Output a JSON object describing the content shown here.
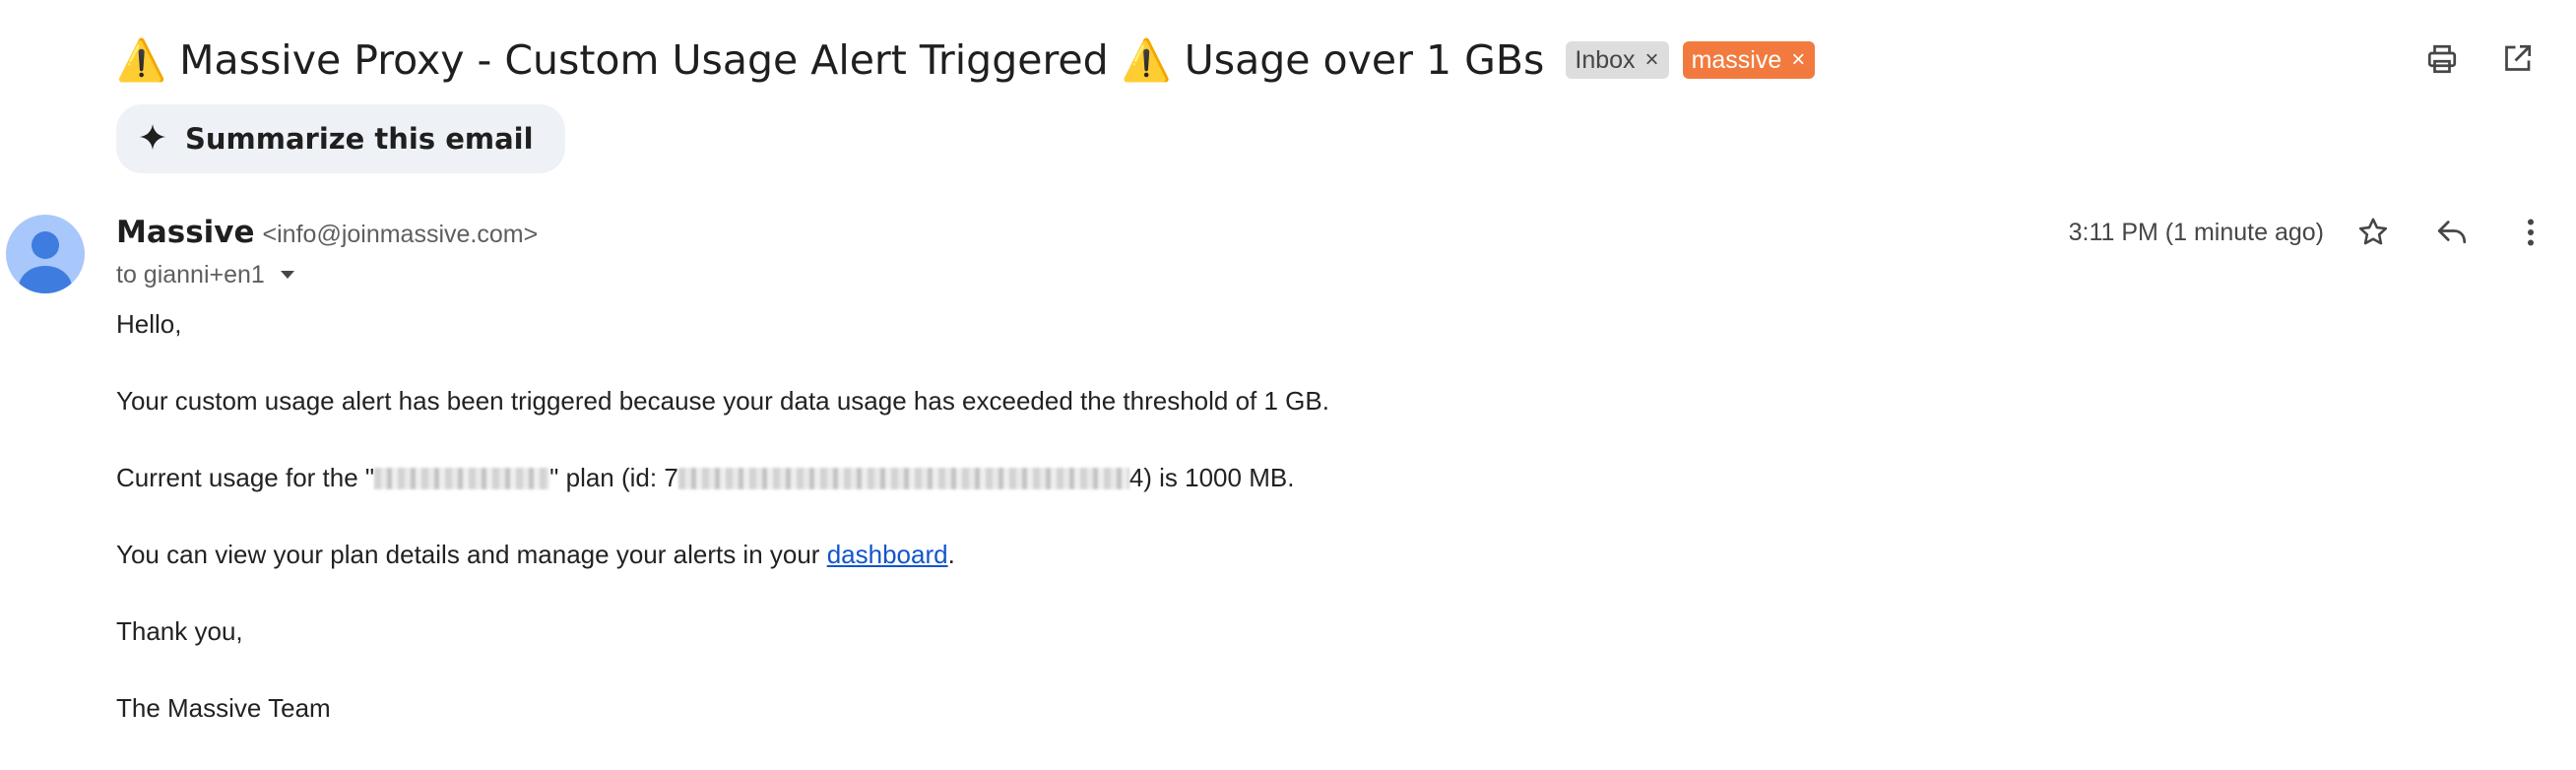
{
  "subject": {
    "text": "⚠️ Massive Proxy - Custom Usage Alert Triggered ⚠️ Usage over 1 GBs",
    "labels": [
      {
        "name": "Inbox",
        "color": "#dddddd",
        "text_color": "#444746"
      },
      {
        "name": "massive",
        "color": "#f27a3e",
        "text_color": "#ffffff"
      }
    ],
    "label_close_glyph": "×"
  },
  "top_actions": {
    "icons": [
      "print-icon",
      "open-in-new-window-icon"
    ]
  },
  "summarize": {
    "label": "Summarize this email",
    "icon": "sparkle-icon"
  },
  "sender": {
    "name": "Massive",
    "email": "<info@joinmassive.com>",
    "recipient": "to gianni+en1",
    "avatar_icon": "person-icon",
    "avatar_color": "#a8c7fa"
  },
  "meta": {
    "timestamp": "3:11 PM (1 minute ago)",
    "icons": [
      "star-icon",
      "reply-icon",
      "more-vert-icon"
    ]
  },
  "body": {
    "greeting": "Hello,",
    "line1": "Your custom usage alert has been triggered because your data usage has exceeded the threshold of 1 GB.",
    "line2_part1": "Current usage for the \"",
    "line2_part2": "\" plan (id: 7",
    "line2_part3": "4) is 1000 MB.",
    "line3_part1": "You can view your plan details and manage your alerts in your ",
    "line3_link": "dashboard",
    "line3_part2": ".",
    "closing": "Thank you,",
    "signature": "The Massive Team"
  },
  "colors": {
    "link": "#1155cc",
    "summarize_bg": "#eef1f6",
    "text": "#1f1f1f"
  }
}
